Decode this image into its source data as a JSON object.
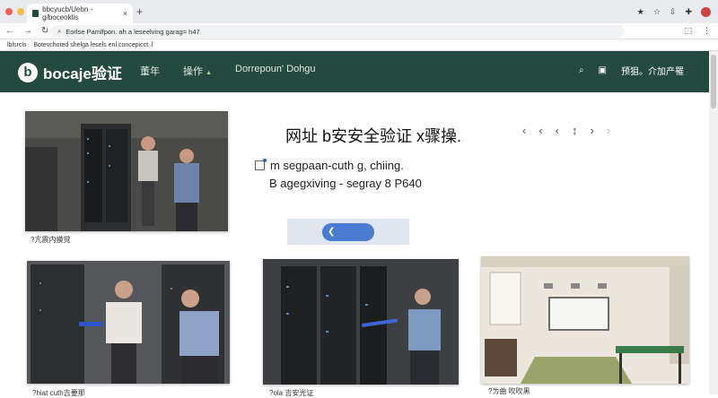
{
  "browser": {
    "tab_title": "bbcyucb/Uebn -g/boceoklis",
    "tab_close": "×",
    "new_tab": "+",
    "address": "Eorlse  Pamlfpon. ah a leseelving garag= h47",
    "bookmarks": [
      "lblsrcls",
      "Botevchoted shelga lesels enl.concepicct..l"
    ],
    "traffic_lights": [
      "#ee5f57",
      "#f5bd4f",
      "#5ac05a"
    ]
  },
  "site": {
    "logo_text": "bocaje验证",
    "nav": [
      "董年",
      "操作",
      "Dorrepoun' Dohgu"
    ],
    "right_label": "预狙。介加产罹",
    "header_color": "#244a40"
  },
  "hero": {
    "headline": "网址 b安安全验证 x骤操.",
    "line1": "m segpaan-cuth g, chiing.",
    "line2": "B agegxiving - segray 8 P640",
    "carousel_arrows": [
      "‹",
      "‹",
      "‹",
      "↕",
      "›",
      "›"
    ]
  },
  "captions": {
    "photo1": "?亢震内摸觉",
    "photo2": "?hiat cuth吉要那",
    "photo3": "?ola 吉安光证",
    "photo4": "?ㄌ曲 吹吹黑"
  }
}
